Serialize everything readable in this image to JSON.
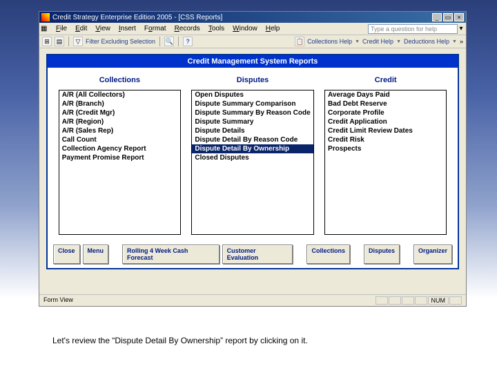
{
  "titlebar": {
    "title": "Credit Strategy Enterprise Edition 2005 - [CSS Reports]"
  },
  "menubar": {
    "items": [
      "File",
      "Edit",
      "View",
      "Insert",
      "Format",
      "Records",
      "Tools",
      "Window",
      "Help"
    ],
    "question_placeholder": "Type a question for help"
  },
  "toolbar": {
    "filter_label": "Filter Excluding Selection",
    "links": [
      "Collections Help",
      "Credit Help",
      "Deductions Help"
    ]
  },
  "report": {
    "title": "Credit Management System Reports",
    "columns": [
      {
        "header": "Collections",
        "items": [
          "A/R (All Collectors)",
          "A/R (Branch)",
          "A/R (Credit Mgr)",
          "A/R (Region)",
          "A/R (Sales Rep)",
          "Call Count",
          "Collection Agency Report",
          "Payment Promise Report"
        ]
      },
      {
        "header": "Disputes",
        "items": [
          "Open Disputes",
          "Dispute Summary Comparison",
          "Dispute Summary By Reason Code",
          "Dispute Summary",
          "Dispute Details",
          "Dispute Detail By Reason Code",
          "Dispute Detail By Ownership",
          "Closed Disputes"
        ],
        "selected": 6
      },
      {
        "header": "Credit",
        "items": [
          "Average Days Paid",
          "Bad Debt Reserve",
          "Corporate Profile",
          "Credit Application",
          "Credit Limit Review Dates",
          "Credit Risk",
          "Prospects"
        ]
      }
    ]
  },
  "buttons": [
    "Close",
    "Menu",
    "Rolling 4 Week Cash Forecast",
    "Customer Evaluation",
    "Collections",
    "Disputes",
    "Organizer"
  ],
  "statusbar": {
    "left": "Form View",
    "indicator": "NUM"
  },
  "caption": "Let's review the “Dispute Detail By Ownership” report by clicking on it."
}
